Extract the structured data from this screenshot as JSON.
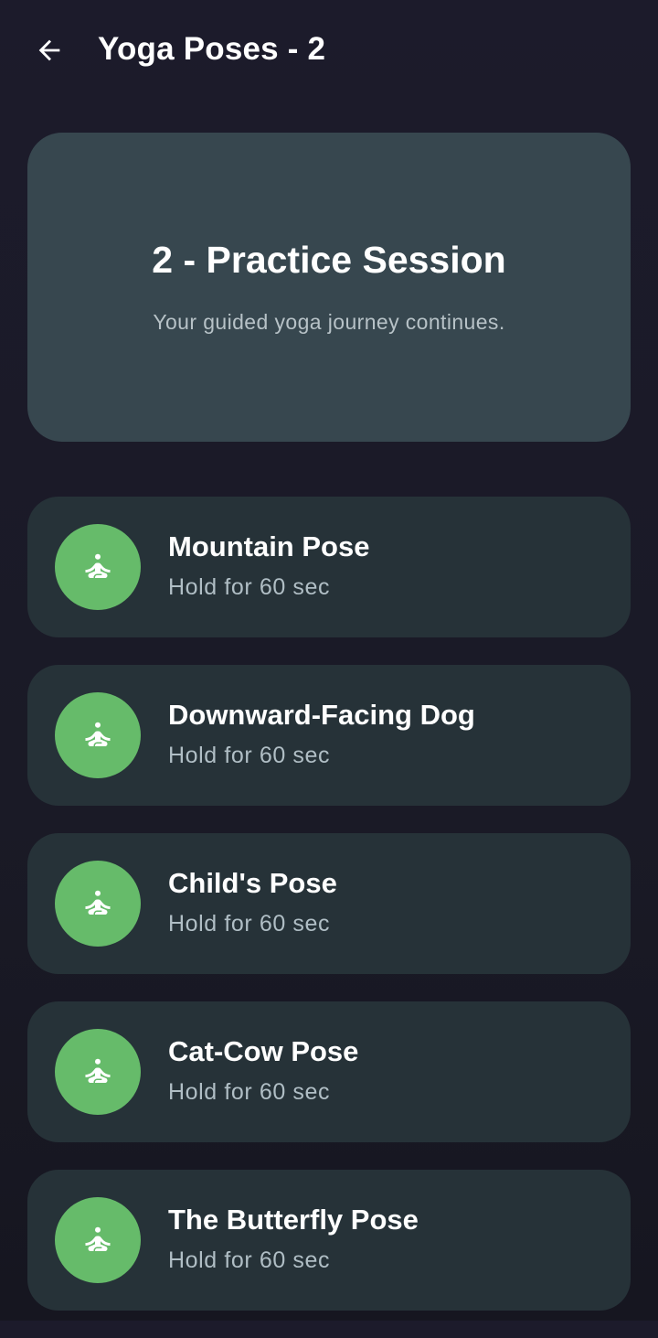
{
  "app_bar": {
    "back_icon": "arrow-left-icon",
    "title": "Yoga Poses - 2"
  },
  "hero": {
    "title": "2 - Practice Session",
    "subtitle": "Your guided yoga journey continues."
  },
  "poses": [
    {
      "name": "Mountain Pose",
      "duration": "Hold for 60 sec",
      "icon": "meditation-icon"
    },
    {
      "name": "Downward-Facing Dog",
      "duration": "Hold for 60 sec",
      "icon": "meditation-icon"
    },
    {
      "name": "Child's Pose",
      "duration": "Hold for 60 sec",
      "icon": "meditation-icon"
    },
    {
      "name": "Cat-Cow Pose",
      "duration": "Hold for 60 sec",
      "icon": "meditation-icon"
    },
    {
      "name": "The Butterfly Pose",
      "duration": "Hold for 60 sec",
      "icon": "meditation-icon"
    }
  ],
  "colors": {
    "background": "#1c1b2b",
    "hero_card": "#37474f",
    "list_card": "#263238",
    "accent_green": "#66bb6a",
    "subtitle_text": "#b0bec5"
  }
}
